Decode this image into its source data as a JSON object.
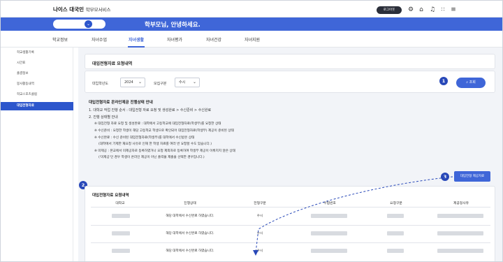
{
  "topbar": {
    "brand": "나이스 대국민",
    "brand_sub": "학부모서비스",
    "logout_label": "로그아웃",
    "icons": [
      "gear-icon",
      "home-icon",
      "bell-icon",
      "grid-icon",
      "menu-icon"
    ]
  },
  "greeting_bar": {
    "greeting": "학부모님, 안녕하세요.",
    "accent": "#3f66d8"
  },
  "nav": {
    "items": [
      "학교정보",
      "자녀수업",
      "자녀생활",
      "자녀평가",
      "자녀건강",
      "자녀지원"
    ],
    "active": "자녀생활"
  },
  "sidebar": {
    "items": [
      "학교생활기록",
      "시간표",
      "출결정보",
      "봉사활동내역",
      "학교스포츠클럽",
      "대입전형자료"
    ],
    "active": "대입전형자료"
  },
  "main": {
    "title": "대입전형자료 요청내역",
    "filter": {
      "year_label": "대입학년도",
      "year_value": "2024",
      "type_label": "모집구분",
      "type_value": "수시",
      "search_label": "조회"
    },
    "info": {
      "heading": "대입전형자료 온라인제공 진행상태 안내",
      "lines": [
        "1. 대학교 작업 진행 순서 : 대입전형 자료 요청 및 생성완료 > 수신준비 > 수신완료",
        "2. 진행 상태별 안내",
        "※ 대입전형 자료 요청 및 생성완료 : 대학에서 고등학교에 대입전형자료(학생부)를 요청한 상태",
        "※ 수신준비 : 요청한 학생이 해당 고등학교 학생으로 확인되어 대입전형자료(학생부) 제공이 준비된 상태",
        "※ 수신완료 : 수신 준비된 대입전형자료(학생부)를 대학에서 수신받은 상태",
        "(대학에서 기제한 재요청 사유로 인해 한 학생 자료를 여러 번 요청할 수도 있습니다.)",
        "※ 미제공 : 본교에서 미제공자로 등록하였거나 요청 제외자로 등록하여 학생부 제공이 이뤄지지 않은 상태",
        "('미제공'인 경우 학생이 온라인 제공이 아닌 출력물 제출을 선택한 경우입니다.)"
      ]
    },
    "request_button": "대입전형 제공자료",
    "list": {
      "title": "대입전형자료 요청내역",
      "columns": [
        "대학교",
        "진행상태",
        "전형구분",
        "수험번호",
        "요청구분",
        "제공정사유"
      ],
      "rows": [
        {
          "status": "해당 대학에서 수신완료 하였습니다.",
          "type": "수시"
        },
        {
          "status": "해당 대학에서 수신완료 하였습니다.",
          "type": "수시"
        },
        {
          "status": "해당 대학에서 수신완료 하였습니다.",
          "type": "수시"
        }
      ]
    },
    "badges": [
      "1",
      "2",
      "3"
    ]
  }
}
